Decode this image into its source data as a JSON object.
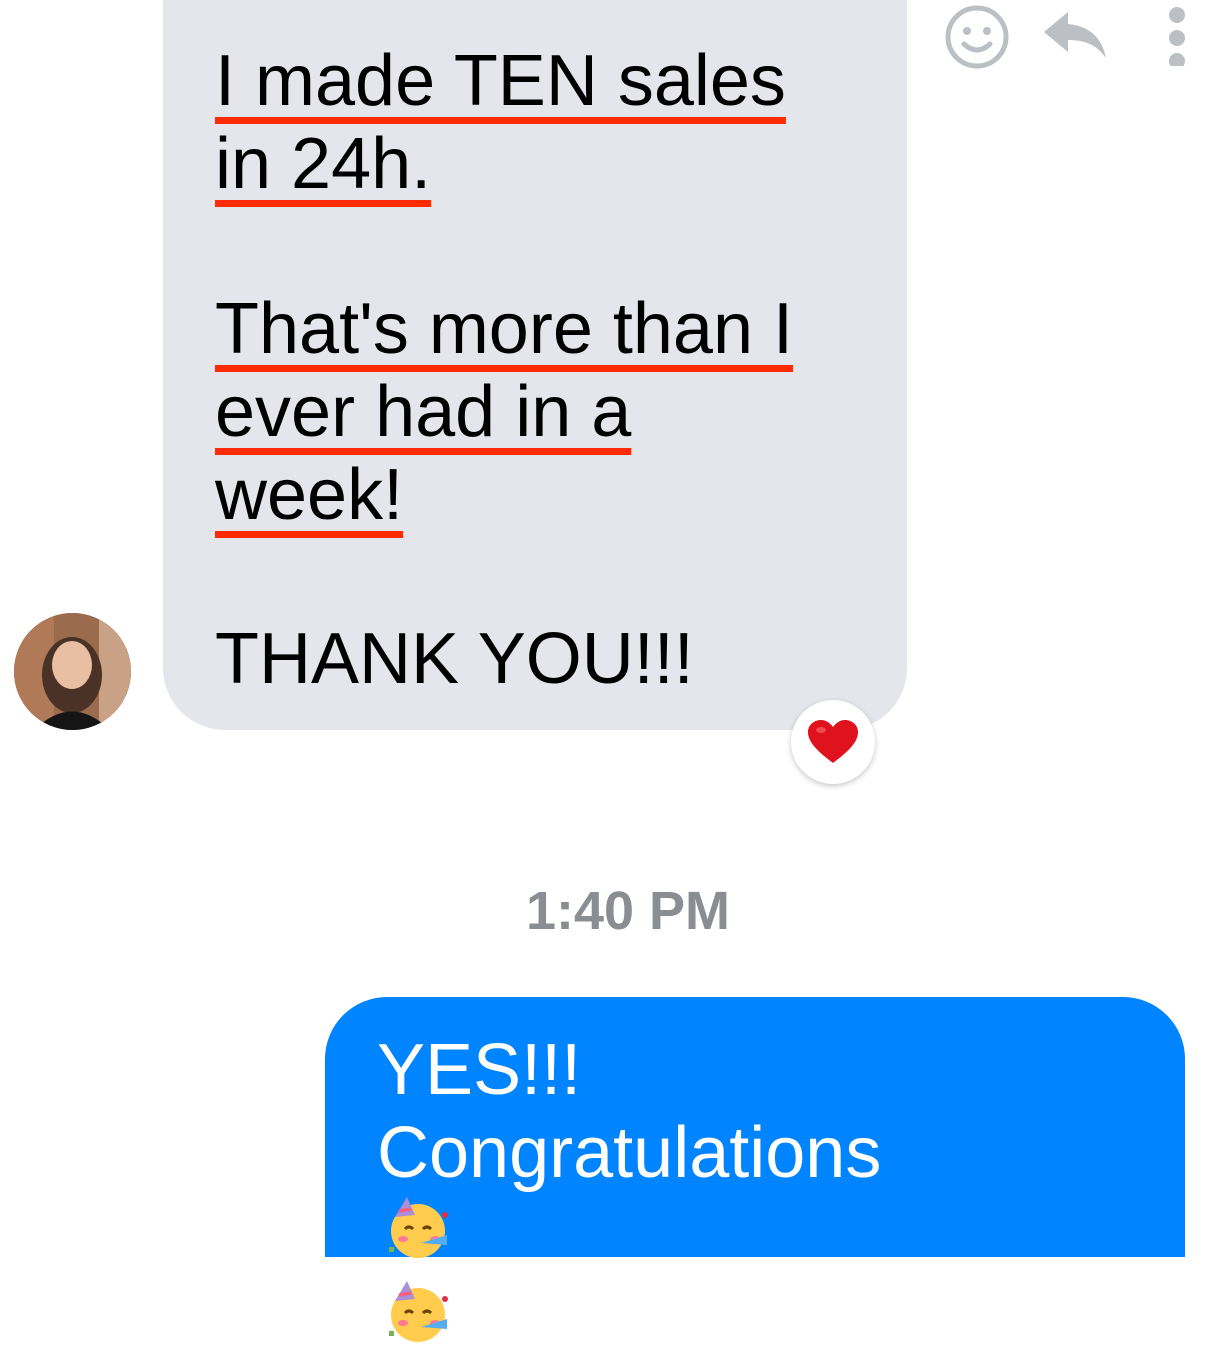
{
  "incoming_message": {
    "paragraph_1": [
      "I made TEN sales",
      "in 24h."
    ],
    "paragraph_2": [
      "That's more than I",
      "ever had in a",
      "week!"
    ],
    "paragraph_3": "THANK YOU!!!",
    "reaction": "heart",
    "highlight_color": "#ff2a00",
    "bubble_color": "#e4e6eb"
  },
  "message_actions": {
    "react_icon": "smiley-face-icon",
    "reply_icon": "reply-arrow-icon",
    "more_icon": "vertical-dots-icon"
  },
  "timestamp": "1:40 PM",
  "outgoing_message": {
    "line_1": "YES!!!",
    "line_2": "Congratulations",
    "emojis": [
      "partying-face",
      "partying-face"
    ],
    "bubble_color": "#0084ff"
  }
}
